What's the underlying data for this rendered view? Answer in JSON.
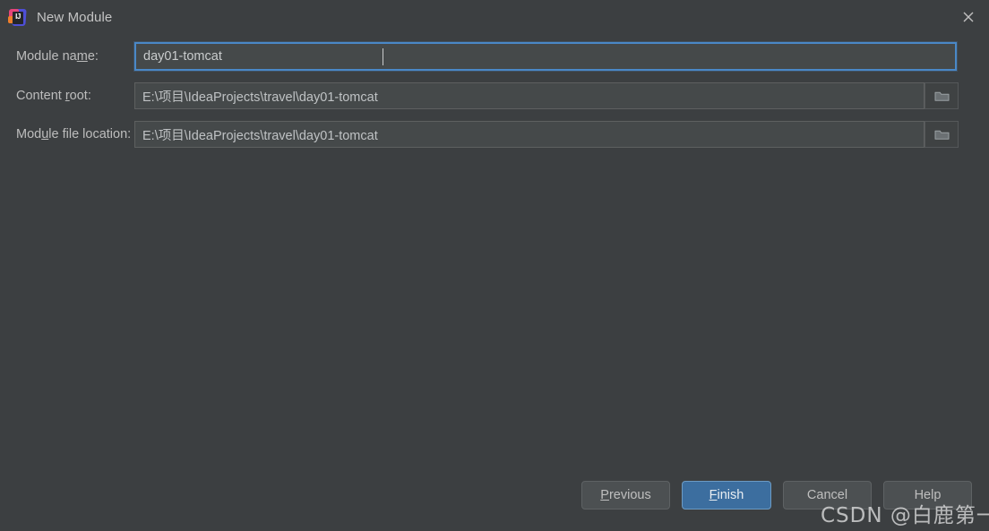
{
  "window": {
    "title": "New Module",
    "app_icon": "intellij-idea-icon",
    "icon_text": "IJ",
    "close_icon": "close-icon"
  },
  "colors": {
    "background": "#3c3f41",
    "field_background": "#45494a",
    "focus_border": "#4a88c7",
    "primary_button": "#3c6e9f",
    "text": "#bbbbbb"
  },
  "form": {
    "fields": [
      {
        "label_pre": "Module na",
        "label_mnemonic": "m",
        "label_post": "e:",
        "value": "day01-tomcat",
        "focused": true,
        "has_browse": false
      },
      {
        "label_pre": "Content ",
        "label_mnemonic": "r",
        "label_post": "oot:",
        "value": "E:\\项目\\IdeaProjects\\travel\\day01-tomcat",
        "focused": false,
        "has_browse": true,
        "browse_icon": "folder-icon"
      },
      {
        "label_pre": "Mod",
        "label_mnemonic": "u",
        "label_post": "le file location:",
        "value": "E:\\项目\\IdeaProjects\\travel\\day01-tomcat",
        "focused": false,
        "has_browse": true,
        "browse_icon": "folder-icon"
      }
    ]
  },
  "buttons": {
    "previous": {
      "pre": "",
      "mnemonic": "P",
      "post": "revious"
    },
    "finish": {
      "pre": "",
      "mnemonic": "F",
      "post": "inish"
    },
    "cancel": {
      "pre": "Cancel",
      "mnemonic": "",
      "post": ""
    },
    "help": {
      "pre": "Help",
      "mnemonic": "",
      "post": ""
    }
  },
  "watermark": {
    "text": "CSDN @白鹿第一帅"
  }
}
